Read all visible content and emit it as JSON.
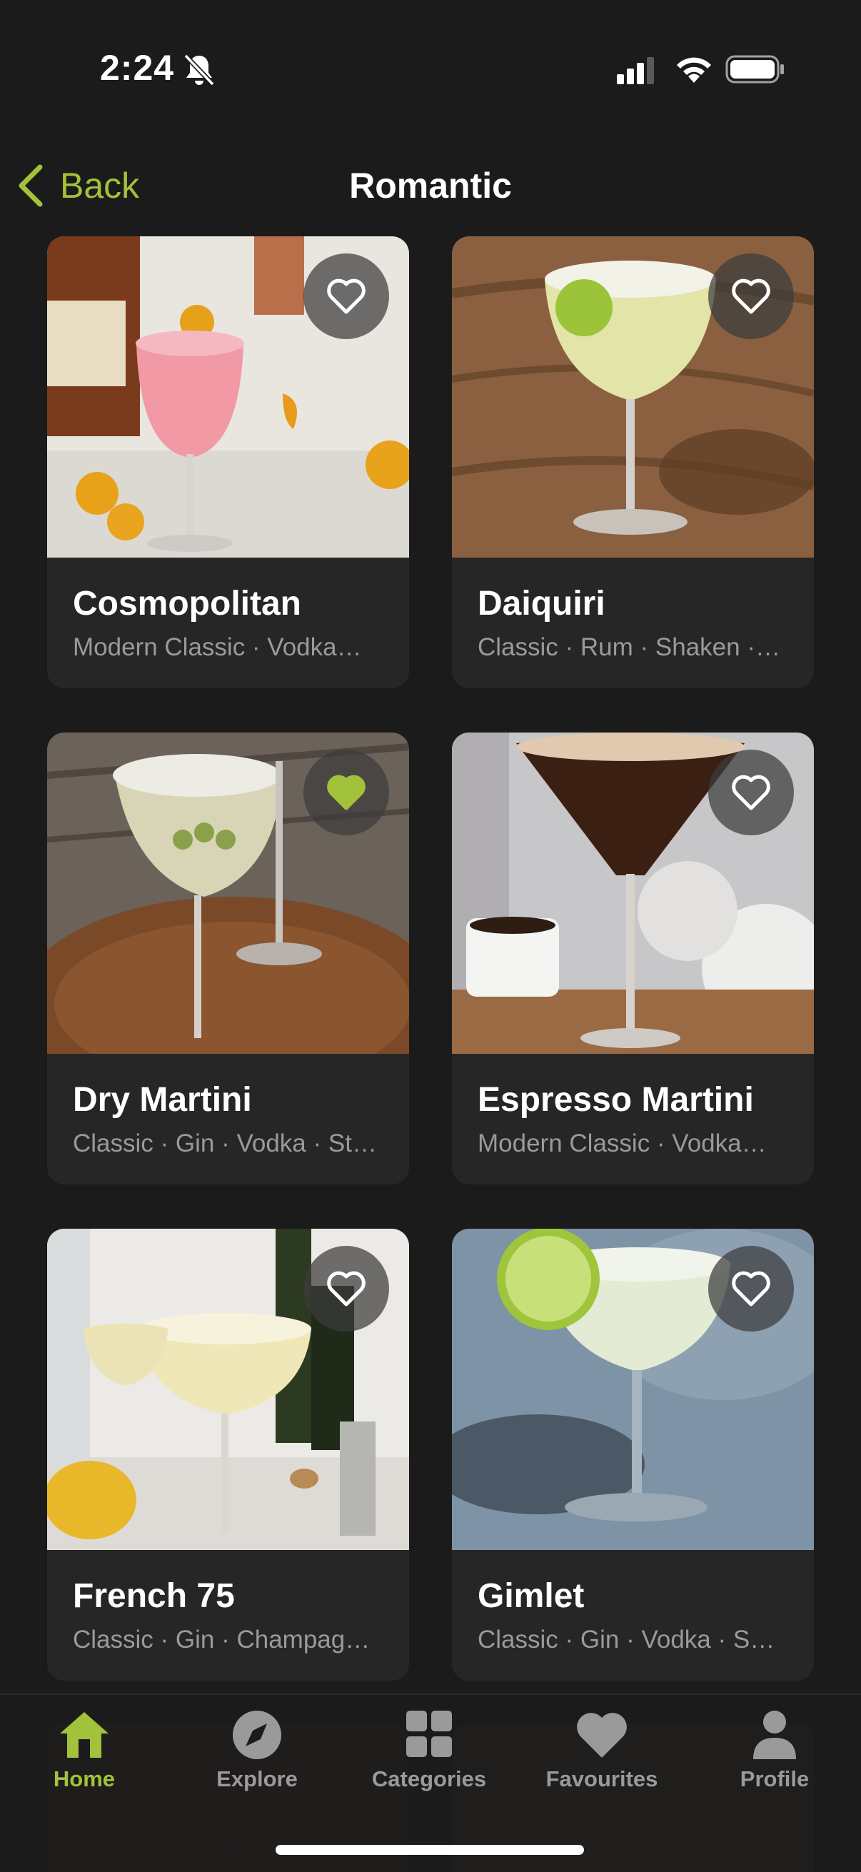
{
  "status_bar": {
    "time": "2:24"
  },
  "nav": {
    "back_label": "Back",
    "title": "Romantic"
  },
  "colors": {
    "accent": "#a3c23b",
    "background": "#1b1b1b",
    "card": "#262626"
  },
  "cocktails": [
    {
      "name": "Cosmopolitan",
      "tags": "Modern Classic · Vodka…",
      "favourite": false
    },
    {
      "name": "Daiquiri",
      "tags": "Classic · Rum · Shaken ·…",
      "favourite": false
    },
    {
      "name": "Dry Martini",
      "tags": "Classic · Gin · Vodka · St…",
      "favourite": true
    },
    {
      "name": "Espresso Martini",
      "tags": "Modern Classic · Vodka…",
      "favourite": false
    },
    {
      "name": "French 75",
      "tags": "Classic · Gin · Champag…",
      "favourite": false
    },
    {
      "name": "Gimlet",
      "tags": "Classic · Gin · Vodka · S…",
      "favourite": false
    }
  ],
  "tabs": [
    {
      "label": "Home",
      "icon": "home-icon",
      "active": true
    },
    {
      "label": "Explore",
      "icon": "compass-icon",
      "active": false
    },
    {
      "label": "Categories",
      "icon": "grid-icon",
      "active": false
    },
    {
      "label": "Favourites",
      "icon": "heart-icon",
      "active": false
    },
    {
      "label": "Profile",
      "icon": "person-icon",
      "active": false
    }
  ]
}
